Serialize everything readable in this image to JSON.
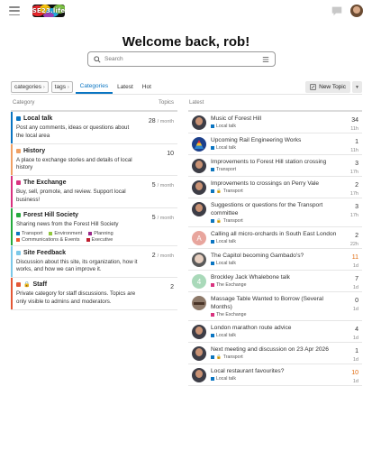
{
  "header": {
    "logo_text": "SE23.life",
    "colors": {
      "logo_bg": "#111111"
    }
  },
  "welcome": "Welcome back, rob!",
  "search": {
    "placeholder": "Search"
  },
  "nav": {
    "categories_dropdown": "categories",
    "tags_dropdown": "tags",
    "tabs": [
      "Categories",
      "Latest",
      "Hot"
    ],
    "active_tab": "Categories",
    "new_topic": "New Topic"
  },
  "columns": {
    "category": "Category",
    "topics": "Topics",
    "latest": "Latest"
  },
  "categories": [
    {
      "name": "Local talk",
      "color": "#0a75c2",
      "count": "28",
      "per": "/ month",
      "description": "Post any comments, ideas or questions about the local area"
    },
    {
      "name": "History",
      "color": "#f0a064",
      "count": "10",
      "per": "",
      "description": "A place to exchange stories and details of local history"
    },
    {
      "name": "The Exchange",
      "color": "#d9327f",
      "count": "5",
      "per": "/ month",
      "description": "Buy, sell, promote, and review. Support local business!"
    },
    {
      "name": "Forest Hill Society",
      "color": "#25aa3d",
      "count": "5",
      "per": "/ month",
      "description": "Sharing news from the Forest Hill Society",
      "subcategories": [
        {
          "name": "Transport",
          "color": "#0e76bd"
        },
        {
          "name": "Environment",
          "color": "#92c83e"
        },
        {
          "name": "Planning",
          "color": "#9a2a8a"
        },
        {
          "name": "Communications & Events",
          "color": "#f1592a"
        },
        {
          "name": "Executive",
          "color": "#bf1e2e"
        }
      ]
    },
    {
      "name": "Site Feedback",
      "color": "#7bc8e8",
      "count": "2",
      "per": "/ month",
      "description": "Discussion about this site, its organization, how it works, and how we can improve it."
    },
    {
      "name": "Staff",
      "color": "#e45735",
      "count": "2",
      "per": "",
      "description": "Private category for staff discussions. Topics are only visible to admins and moderators."
    }
  ],
  "topics": [
    {
      "title": "Music of Forest Hill",
      "category": "Local talk",
      "cat_color": "#0a75c2",
      "locked": false,
      "count": "34",
      "age": "11h",
      "hot": false,
      "avatar": "photo",
      "avatar_letter": "",
      "avatar_color": ""
    },
    {
      "title": "Upcoming Rail Engineering Works",
      "category": "Local talk",
      "cat_color": "#0a75c2",
      "locked": false,
      "count": "1",
      "age": "11h",
      "hot": false,
      "avatar": "brand",
      "avatar_letter": "",
      "avatar_color": ""
    },
    {
      "title": "Improvements to Forest Hill station crossing",
      "category": "Transport",
      "cat_color": "#0e76bd",
      "locked": false,
      "count": "3",
      "age": "17h",
      "hot": false,
      "avatar": "photo",
      "avatar_letter": "",
      "avatar_color": ""
    },
    {
      "title": "Improvements to crossings on Perry Vale",
      "category": "Transport",
      "cat_color": "#0e76bd",
      "locked": true,
      "count": "2",
      "age": "17h",
      "hot": false,
      "avatar": "photo",
      "avatar_letter": "",
      "avatar_color": ""
    },
    {
      "title": "Suggestions or questions for the Transport committee",
      "category": "Transport",
      "cat_color": "#0e76bd",
      "locked": true,
      "count": "3",
      "age": "17h",
      "hot": false,
      "avatar": "photo",
      "avatar_letter": "",
      "avatar_color": ""
    },
    {
      "title": "Calling all micro-orchards in South East London",
      "category": "Local talk",
      "cat_color": "#0a75c2",
      "locked": false,
      "count": "2",
      "age": "22h",
      "hot": false,
      "avatar": "letter",
      "avatar_letter": "A",
      "avatar_color": "#e8a59d"
    },
    {
      "title": "The Capitol becoming Gambado's?",
      "category": "Local talk",
      "cat_color": "#0a75c2",
      "locked": false,
      "count": "11",
      "age": "1d",
      "hot": true,
      "avatar": "old",
      "avatar_letter": "",
      "avatar_color": ""
    },
    {
      "title": "Brockley Jack Whalebone talk",
      "category": "The Exchange",
      "cat_color": "#d9327f",
      "locked": false,
      "count": "7",
      "age": "1d",
      "hot": false,
      "avatar": "letter",
      "avatar_letter": "4",
      "avatar_color": "#a9d9b9"
    },
    {
      "title": "Massage Table Wanted to Borrow (Several Months)",
      "category": "The Exchange",
      "cat_color": "#d9327f",
      "locked": false,
      "count": "0",
      "age": "1d",
      "hot": false,
      "avatar": "table",
      "avatar_letter": "",
      "avatar_color": ""
    },
    {
      "title": "London marathon route advice",
      "category": "Local talk",
      "cat_color": "#0a75c2",
      "locked": false,
      "count": "4",
      "age": "1d",
      "hot": false,
      "avatar": "photo",
      "avatar_letter": "",
      "avatar_color": ""
    },
    {
      "title": "Next meeting and discussion on 23 Apr 2026",
      "category": "Transport",
      "cat_color": "#0e76bd",
      "locked": true,
      "count": "1",
      "age": "1d",
      "hot": false,
      "avatar": "photo",
      "avatar_letter": "",
      "avatar_color": ""
    },
    {
      "title": "Local restaurant favourites?",
      "category": "Local talk",
      "cat_color": "#0a75c2",
      "locked": false,
      "count": "10",
      "age": "1d",
      "hot": true,
      "avatar": "photo",
      "avatar_letter": "",
      "avatar_color": ""
    }
  ],
  "colors": {
    "accent": "#0a75c2",
    "hot": "#e06b0f"
  }
}
